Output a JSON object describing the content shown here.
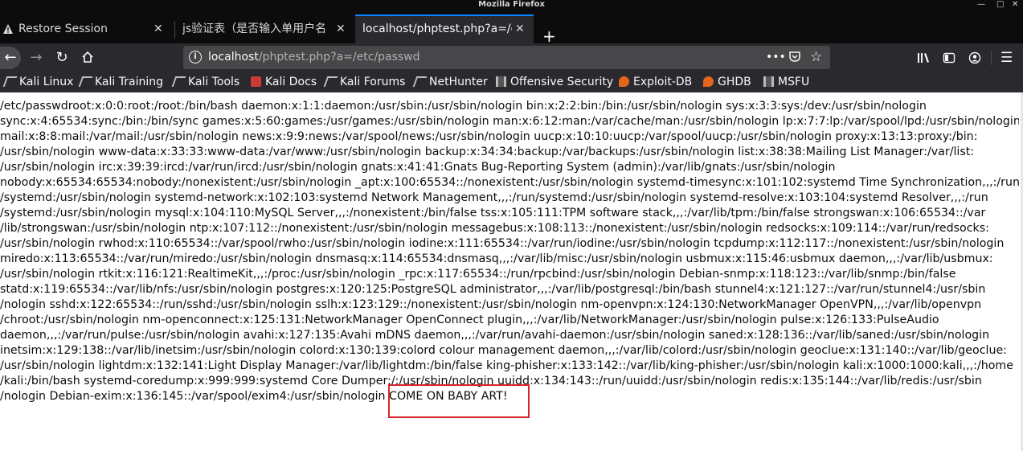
{
  "window": {
    "title": "Mozilla Firefox"
  },
  "tabs": [
    {
      "label": "Restore Session",
      "active": false
    },
    {
      "label": "js验证表（是否输入单用户名",
      "active": false
    },
    {
      "label": "localhost/phptest.php?a=/etc",
      "active": true
    }
  ],
  "navbar": {
    "url_host": "localhost",
    "url_path": "/phptest.php?a=/etc/passwd",
    "url_prefix": "",
    "page_actions_glyph": "•••"
  },
  "bookmarks": [
    {
      "label": "Kali Linux",
      "icon": "kali-dragon-icon"
    },
    {
      "label": "Kali Training",
      "icon": "kali-dragon-icon"
    },
    {
      "label": "Kali Tools",
      "icon": "kali-dragon-icon"
    },
    {
      "label": "Kali Docs",
      "icon": "kali-docs-icon"
    },
    {
      "label": "Kali Forums",
      "icon": "kali-dragon-icon"
    },
    {
      "label": "NetHunter",
      "icon": "kali-dragon-icon"
    },
    {
      "label": "Offensive Security",
      "icon": "offsec-icon"
    },
    {
      "label": "Exploit-DB",
      "icon": "exploit-db-icon"
    },
    {
      "label": "GHDB",
      "icon": "exploit-db-icon"
    },
    {
      "label": "MSFU",
      "icon": "offsec-icon"
    }
  ],
  "page": {
    "lines": [
      "/etc/passwdroot:x:0:0:root:/root:/bin/bash daemon:x:1:1:daemon:/usr/sbin:/usr/sbin/nologin bin:x:2:2:bin:/bin:/usr/sbin/nologin sys:x:3:3:sys:/dev:/usr/sbin/nologin",
      "sync:x:4:65534:sync:/bin:/bin/sync games:x:5:60:games:/usr/games:/usr/sbin/nologin man:x:6:12:man:/var/cache/man:/usr/sbin/nologin lp:x:7:7:lp:/var/spool/lpd:/usr/sbin/nologin",
      "mail:x:8:8:mail:/var/mail:/usr/sbin/nologin news:x:9:9:news:/var/spool/news:/usr/sbin/nologin uucp:x:10:10:uucp:/var/spool/uucp:/usr/sbin/nologin proxy:x:13:13:proxy:/bin:",
      "/usr/sbin/nologin www-data:x:33:33:www-data:/var/www:/usr/sbin/nologin backup:x:34:34:backup:/var/backups:/usr/sbin/nologin list:x:38:38:Mailing List Manager:/var/list:",
      "/usr/sbin/nologin irc:x:39:39:ircd:/var/run/ircd:/usr/sbin/nologin gnats:x:41:41:Gnats Bug-Reporting System (admin):/var/lib/gnats:/usr/sbin/nologin",
      "nobody:x:65534:65534:nobody:/nonexistent:/usr/sbin/nologin _apt:x:100:65534::/nonexistent:/usr/sbin/nologin systemd-timesync:x:101:102:systemd Time Synchronization,,,:/run",
      "/systemd:/usr/sbin/nologin systemd-network:x:102:103:systemd Network Management,,,:/run/systemd:/usr/sbin/nologin systemd-resolve:x:103:104:systemd Resolver,,,:/run",
      "/systemd:/usr/sbin/nologin mysql:x:104:110:MySQL Server,,,:/nonexistent:/bin/false tss:x:105:111:TPM software stack,,,:/var/lib/tpm:/bin/false strongswan:x:106:65534::/var",
      "/lib/strongswan:/usr/sbin/nologin ntp:x:107:112::/nonexistent:/usr/sbin/nologin messagebus:x:108:113::/nonexistent:/usr/sbin/nologin redsocks:x:109:114::/var/run/redsocks:",
      "/usr/sbin/nologin rwhod:x:110:65534::/var/spool/rwho:/usr/sbin/nologin iodine:x:111:65534::/var/run/iodine:/usr/sbin/nologin tcpdump:x:112:117::/nonexistent:/usr/sbin/nologin",
      "miredo:x:113:65534::/var/run/miredo:/usr/sbin/nologin dnsmasq:x:114:65534:dnsmasq,,,:/var/lib/misc:/usr/sbin/nologin usbmux:x:115:46:usbmux daemon,,,:/var/lib/usbmux:",
      "/usr/sbin/nologin rtkit:x:116:121:RealtimeKit,,,:/proc:/usr/sbin/nologin _rpc:x:117:65534::/run/rpcbind:/usr/sbin/nologin Debian-snmp:x:118:123::/var/lib/snmp:/bin/false",
      "statd:x:119:65534::/var/lib/nfs:/usr/sbin/nologin postgres:x:120:125:PostgreSQL administrator,,,:/var/lib/postgresql:/bin/bash stunnel4:x:121:127::/var/run/stunnel4:/usr/sbin",
      "/nologin sshd:x:122:65534::/run/sshd:/usr/sbin/nologin sslh:x:123:129::/nonexistent:/usr/sbin/nologin nm-openvpn:x:124:130:NetworkManager OpenVPN,,,:/var/lib/openvpn",
      "/chroot:/usr/sbin/nologin nm-openconnect:x:125:131:NetworkManager OpenConnect plugin,,,:/var/lib/NetworkManager:/usr/sbin/nologin pulse:x:126:133:PulseAudio",
      "daemon,,,:/var/run/pulse:/usr/sbin/nologin avahi:x:127:135:Avahi mDNS daemon,,,:/var/run/avahi-daemon:/usr/sbin/nologin saned:x:128:136::/var/lib/saned:/usr/sbin/nologin",
      "inetsim:x:129:138::/var/lib/inetsim:/usr/sbin/nologin colord:x:130:139:colord colour management daemon,,,:/var/lib/colord:/usr/sbin/nologin geoclue:x:131:140::/var/lib/geoclue:",
      "/usr/sbin/nologin lightdm:x:132:141:Light Display Manager:/var/lib/lightdm:/bin/false king-phisher:x:133:142::/var/lib/king-phisher:/usr/sbin/nologin kali:x:1000:1000:kali,,,:/home",
      "/kali:/bin/bash systemd-coredump:x:999:999:systemd Core Dumper:/:/usr/sbin/nologin uuidd:x:134:143::/run/uuidd:/usr/sbin/nologin redis:x:135:144::/var/lib/redis:/usr/sbin",
      "/nologin Debian-exim:x:136:145::/var/spool/exim4:/usr/sbin/nologin COME ON BABY ART!"
    ]
  }
}
